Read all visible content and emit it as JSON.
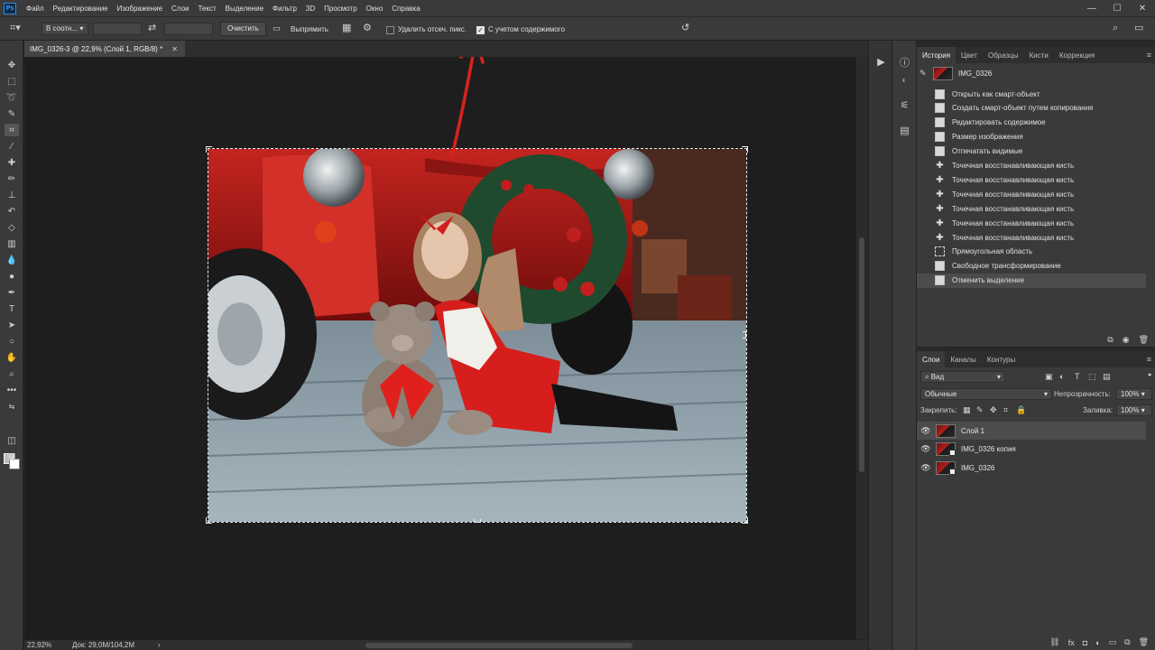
{
  "app": {
    "logo": "Ps",
    "menu": [
      "Файл",
      "Редактирование",
      "Изображение",
      "Слои",
      "Текст",
      "Выделение",
      "Фильтр",
      "3D",
      "Просмотр",
      "Окно",
      "Справка"
    ],
    "window_controls": [
      "—",
      "☐",
      "✕"
    ]
  },
  "options_bar": {
    "ratio_select": "В соотн...",
    "clear_button": "Очистить",
    "straighten_label": "Выпрямить",
    "delete_cropped_label": "Удалить отсеч. пикс.",
    "delete_cropped_checked": false,
    "content_aware_label": "С учетом содержимого",
    "content_aware_checked": true
  },
  "document": {
    "tab_title": "IMG_0326-3 @ 22,9% (Слой 1, RGB/8) *",
    "zoom": "22,92%",
    "doc_info": "Док: 29,0M/104,2M"
  },
  "history_panel": {
    "tabs": [
      "История",
      "Цвет",
      "Образцы",
      "Кисти",
      "Коррекция"
    ],
    "active_tab": 0,
    "snapshot": "IMG_0326",
    "steps": [
      {
        "label": "Открыть как смарт-объект",
        "icon": "doc"
      },
      {
        "label": "Создать смарт-объект путем копирования",
        "icon": "doc"
      },
      {
        "label": "Редактировать содержимое",
        "icon": "doc"
      },
      {
        "label": "Размер изображения",
        "icon": "doc"
      },
      {
        "label": "Отпечатать видимые",
        "icon": "doc"
      },
      {
        "label": "Точечная восстанавливающая кисть",
        "icon": "brush"
      },
      {
        "label": "Точечная восстанавливающая кисть",
        "icon": "brush"
      },
      {
        "label": "Точечная восстанавливающая кисть",
        "icon": "brush"
      },
      {
        "label": "Точечная восстанавливающая кисть",
        "icon": "brush"
      },
      {
        "label": "Точечная восстанавливающая кисть",
        "icon": "brush"
      },
      {
        "label": "Точечная восстанавливающая кисть",
        "icon": "brush"
      },
      {
        "label": "Прямоугольная область",
        "icon": "rect"
      },
      {
        "label": "Свободное трансформирование",
        "icon": "doc"
      },
      {
        "label": "Отменить выделение",
        "icon": "doc"
      }
    ],
    "selected_step": 13
  },
  "layers_panel": {
    "tabs": [
      "Слои",
      "Каналы",
      "Контуры"
    ],
    "active_tab": 0,
    "filter_label": "Вид",
    "blend_mode": "Обычные",
    "opacity_label": "Непрозрачность:",
    "opacity_value": "100%",
    "lock_label": "Закрепить:",
    "fill_label": "Заливка:",
    "fill_value": "100%",
    "layers": [
      {
        "name": "Слой 1",
        "smart": false,
        "selected": true
      },
      {
        "name": "IMG_0326 копия",
        "smart": true,
        "selected": false
      },
      {
        "name": "IMG_0326",
        "smart": true,
        "selected": false
      }
    ]
  },
  "annotation": {
    "color": "#d8231c"
  }
}
